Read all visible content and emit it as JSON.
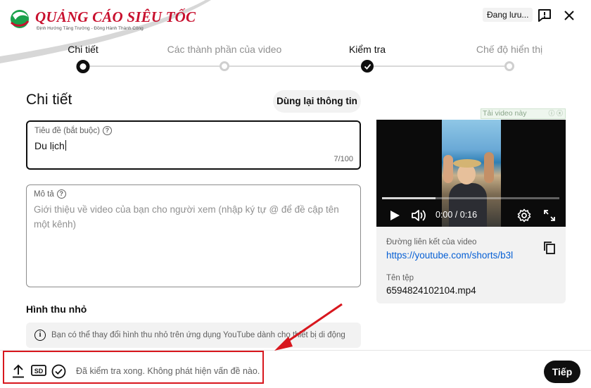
{
  "header": {
    "logo_text": "QUẢNG CÁO SIÊU TỐC",
    "logo_tagline": "Định Hướng Tăng Trưởng - Đồng Hành Thành Công",
    "save_status": "Đang lưu...",
    "feedback_icon": "feedback-icon",
    "close_icon": "close-icon"
  },
  "stepper": {
    "steps": [
      {
        "label": "Chi tiết",
        "state": "current"
      },
      {
        "label": "Các thành phần của video",
        "state": "future"
      },
      {
        "label": "Kiểm tra",
        "state": "done"
      },
      {
        "label": "Chế độ hiển thị",
        "state": "future"
      }
    ]
  },
  "main": {
    "title": "Chi tiết",
    "reuse_button": "Dùng lại thông tin",
    "title_field": {
      "label": "Tiêu đề (bắt buộc)",
      "value": "Du lịch",
      "counter": "7/100"
    },
    "description_field": {
      "label": "Mô tả",
      "placeholder": "Giới thiệu về video của bạn cho người xem (nhập ký tự @ để đề cập tên một kênh)"
    },
    "thumbnail": {
      "heading": "Hình thu nhỏ",
      "info": "Bạn có thể thay đổi hình thu nhỏ trên ứng dụng YouTube dành cho thiết bị di động"
    }
  },
  "preview": {
    "ad_banner": "Tải video này",
    "ad_banner_icons": "ⓘ ⓧ",
    "time": "0:00 / 0:16",
    "progress": 0.0,
    "buffered": 0.3,
    "link_label": "Đường liên kết của video",
    "link_value": "https://youtube.com/shorts/b3l",
    "file_label": "Tên tệp",
    "file_value": "6594824102104.mp4",
    "icons": [
      "play-icon",
      "volume-icon",
      "settings-icon",
      "fullscreen-icon",
      "copy-icon"
    ]
  },
  "footer": {
    "status": "Đã kiểm tra xong. Không phát hiện vấn đề nào.",
    "next_button": "Tiếp",
    "icons": [
      "upload-icon",
      "sd-badge-icon",
      "check-circle-icon"
    ]
  },
  "colors": {
    "accent_link": "#065fd4",
    "highlight_red": "#d8171e",
    "logo_red": "#c8102e"
  }
}
